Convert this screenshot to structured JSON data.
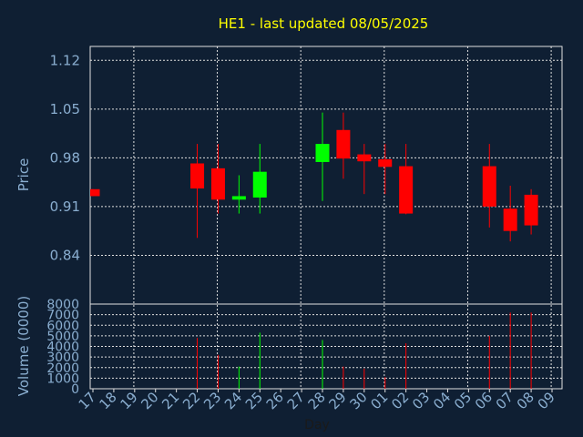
{
  "chart_data": {
    "type": "candlestick",
    "title": "HE1 - last updated 08/05/2025",
    "xlabel": "Day",
    "price_panel": {
      "ylabel": "Price",
      "yticks": [
        "0.84",
        "0.91",
        "0.98",
        "1.05",
        "1.12"
      ],
      "ylim": [
        0.77,
        1.14
      ]
    },
    "volume_panel": {
      "ylabel": "Volume (0000)",
      "yticks": [
        "0",
        "1000",
        "2000",
        "3000",
        "4000",
        "5000",
        "6000",
        "7000",
        "8000"
      ],
      "ylim": [
        0,
        8000
      ]
    },
    "x_labels": [
      "17",
      "18",
      "19",
      "20",
      "21",
      "22",
      "23",
      "24",
      "25",
      "26",
      "27",
      "28",
      "29",
      "30",
      "01",
      "02",
      "03",
      "04",
      "05",
      "06",
      "07",
      "08",
      "09"
    ],
    "grid": true,
    "colors": {
      "background": "#0f1f33",
      "up": "#00ff00",
      "down": "#ff0000",
      "grid": "#e0e0e0",
      "axis_text": "#8aaed0",
      "title": "#ffff00"
    },
    "candles": [
      {
        "day": "17",
        "open": 0.935,
        "high": 0.935,
        "low": 0.925,
        "close": 0.925,
        "volume": 0
      },
      {
        "day": "22",
        "open": 0.972,
        "high": 1.0,
        "low": 0.865,
        "close": 0.936,
        "volume": 4800
      },
      {
        "day": "23",
        "open": 0.965,
        "high": 1.0,
        "low": 0.9,
        "close": 0.92,
        "volume": 3200
      },
      {
        "day": "24",
        "open": 0.92,
        "high": 0.955,
        "low": 0.9,
        "close": 0.925,
        "volume": 2100
      },
      {
        "day": "25",
        "open": 0.923,
        "high": 1.0,
        "low": 0.9,
        "close": 0.96,
        "volume": 5300
      },
      {
        "day": "28",
        "open": 0.974,
        "high": 1.045,
        "low": 0.918,
        "close": 1.0,
        "volume": 4600
      },
      {
        "day": "29",
        "open": 1.02,
        "high": 1.045,
        "low": 0.95,
        "close": 0.979,
        "volume": 2100
      },
      {
        "day": "30",
        "open": 0.985,
        "high": 1.0,
        "low": 0.928,
        "close": 0.975,
        "volume": 1900
      },
      {
        "day": "01",
        "open": 0.978,
        "high": 1.0,
        "low": 0.928,
        "close": 0.967,
        "volume": 1100
      },
      {
        "day": "02",
        "open": 0.968,
        "high": 1.0,
        "low": 0.899,
        "close": 0.9,
        "volume": 4300
      },
      {
        "day": "06",
        "open": 0.968,
        "high": 1.0,
        "low": 0.88,
        "close": 0.91,
        "volume": 5000
      },
      {
        "day": "07",
        "open": 0.907,
        "high": 0.94,
        "low": 0.86,
        "close": 0.875,
        "volume": 7200
      },
      {
        "day": "08",
        "open": 0.927,
        "high": 0.935,
        "low": 0.87,
        "close": 0.883,
        "volume": 7200
      }
    ]
  }
}
